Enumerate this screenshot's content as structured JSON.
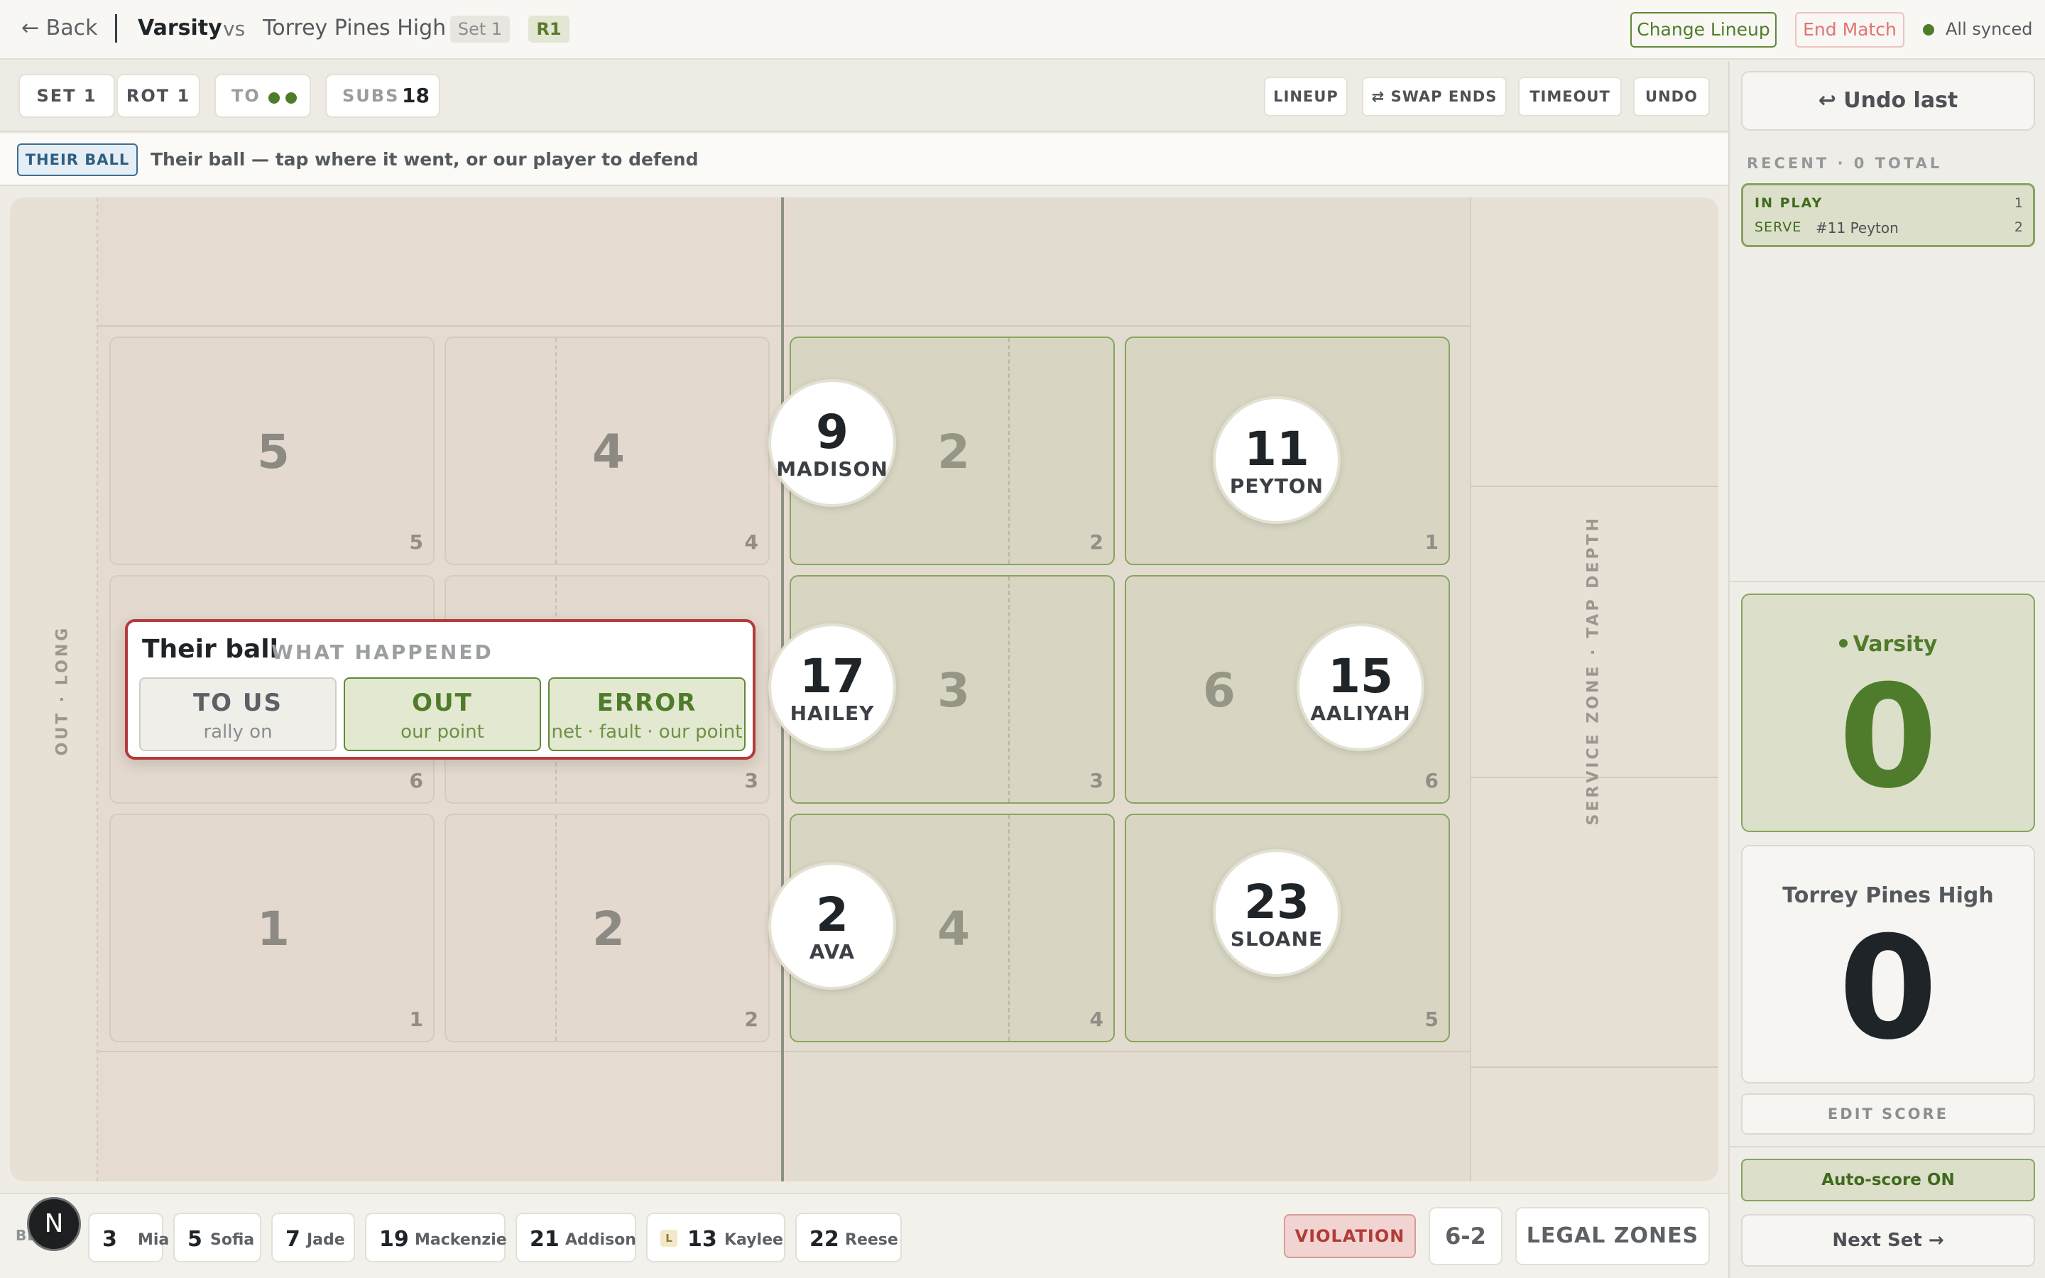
{
  "header": {
    "back_label": "← Back",
    "home_team": "Varsity",
    "vs_label": "vs",
    "away_team": "Torrey Pines High",
    "set_chip": "Set 1",
    "rotation_chip": "R1",
    "change_lineup_label": "Change Lineup",
    "end_match_label": "End Match",
    "sync_status": "All synced"
  },
  "toolbar": {
    "set_label": "SET 1",
    "rot_label": "ROT 1",
    "to_label": "TO",
    "timeouts_remaining": 2,
    "subs_label": "SUBS",
    "subs_count": "18",
    "lineup_label": "LINEUP",
    "swap_ends_label": "⇄ SWAP ENDS",
    "timeout_label": "TIMEOUT",
    "undo_label": "UNDO"
  },
  "status": {
    "ball_badge": "THEIR BALL",
    "prompt": "Their ball — tap where it went, or our player to defend"
  },
  "court": {
    "out_long_label": "OUT · LONG",
    "service_zone_label": "SERVICE ZONE · TAP DEPTH",
    "their_zones": [
      {
        "big": "5",
        "small": "5"
      },
      {
        "big": "4",
        "small": "4"
      },
      {
        "big": "6",
        "small": "6"
      },
      {
        "big": "3",
        "small": "3"
      },
      {
        "big": "1",
        "small": "1"
      },
      {
        "big": "2",
        "small": "2"
      }
    ],
    "our_zones": [
      {
        "big": "2",
        "small": "2"
      },
      {
        "big": "",
        "small": "1"
      },
      {
        "big": "3",
        "small": "3"
      },
      {
        "big": "6",
        "small": "6"
      },
      {
        "big": "4",
        "small": "4"
      },
      {
        "big": "",
        "small": "5"
      }
    ],
    "players": [
      {
        "number": "9",
        "name": "MADISON"
      },
      {
        "number": "11",
        "name": "PEYTON"
      },
      {
        "number": "17",
        "name": "HAILEY"
      },
      {
        "number": "15",
        "name": "AALIYAH"
      },
      {
        "number": "2",
        "name": "AVA"
      },
      {
        "number": "23",
        "name": "SLOANE"
      }
    ]
  },
  "popup": {
    "title": "Their ball",
    "subtitle": "WHAT HAPPENED",
    "options": [
      {
        "label": "TO US",
        "sub": "rally on"
      },
      {
        "label": "OUT",
        "sub": "our point"
      },
      {
        "label": "ERROR",
        "sub": "net · fault · our point"
      }
    ]
  },
  "bench": {
    "label": "BENCH",
    "fab_label": "N",
    "players": [
      {
        "number": "3",
        "name": "Mia"
      },
      {
        "number": "5",
        "name": "Sofia"
      },
      {
        "number": "7",
        "name": "Jade"
      },
      {
        "number": "19",
        "name": "Mackenzie"
      },
      {
        "number": "21",
        "name": "Addison"
      },
      {
        "number": "13",
        "name": "Kaylee",
        "badge": "L"
      },
      {
        "number": "22",
        "name": "Reese"
      }
    ],
    "violation_label": "VIOLATION",
    "formation_label": "6-2",
    "legal_zones_label": "LEGAL ZONES"
  },
  "sidebar": {
    "undo_last_label": "↩ Undo last",
    "recent_label": "RECENT · 0 TOTAL",
    "recent_item": {
      "label": "IN PLAY",
      "count_top": "1",
      "action": "SERVE",
      "player": "#11 Peyton",
      "count_bottom": "2"
    },
    "home_name": "Varsity",
    "home_score": "0",
    "away_name": "Torrey Pines High",
    "away_score": "0",
    "edit_score_label": "EDIT SCORE",
    "auto_score_label": "Auto-score ON",
    "next_set_label": "Next Set →"
  },
  "colors": {
    "accent_green": "#4f7c2a",
    "danger_red": "#b53a3a",
    "ball_blue": "#3a76a1"
  }
}
